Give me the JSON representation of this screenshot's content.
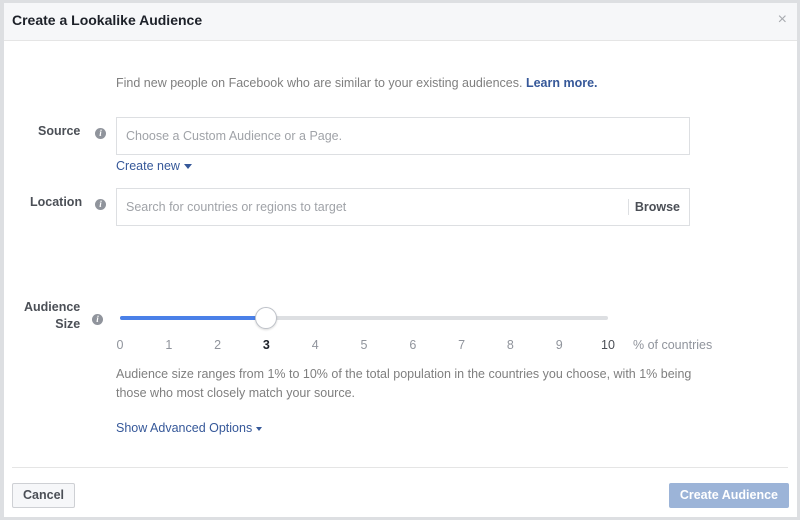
{
  "dialog": {
    "title": "Create a Lookalike Audience",
    "close_icon": "×"
  },
  "intro": {
    "text": "Find new people on Facebook who are similar to your existing audiences. ",
    "link": "Learn more."
  },
  "source": {
    "label": "Source",
    "info_icon": "i",
    "placeholder": "Choose a Custom Audience or a Page.",
    "create_new": "Create new"
  },
  "location": {
    "label": "Location",
    "info_icon": "i",
    "placeholder": "Search for countries or regions to target",
    "browse": "Browse"
  },
  "audience_size": {
    "label_line1": "Audience",
    "label_line2": "Size",
    "info_icon": "i",
    "min": 0,
    "max": 10,
    "value": 3,
    "ticks": [
      "0",
      "1",
      "2",
      "3",
      "4",
      "5",
      "6",
      "7",
      "8",
      "9",
      "10"
    ],
    "unit": "% of countries",
    "help": "Audience size ranges from 1% to 10% of the total population in the countries you choose, with 1% being those who most closely match your source."
  },
  "advanced": {
    "label": "Show Advanced Options"
  },
  "footer": {
    "cancel": "Cancel",
    "create": "Create Audience"
  },
  "colors": {
    "link": "#365899",
    "slider_fill": "#4a80e8",
    "primary_disabled": "#9cb4d8"
  }
}
